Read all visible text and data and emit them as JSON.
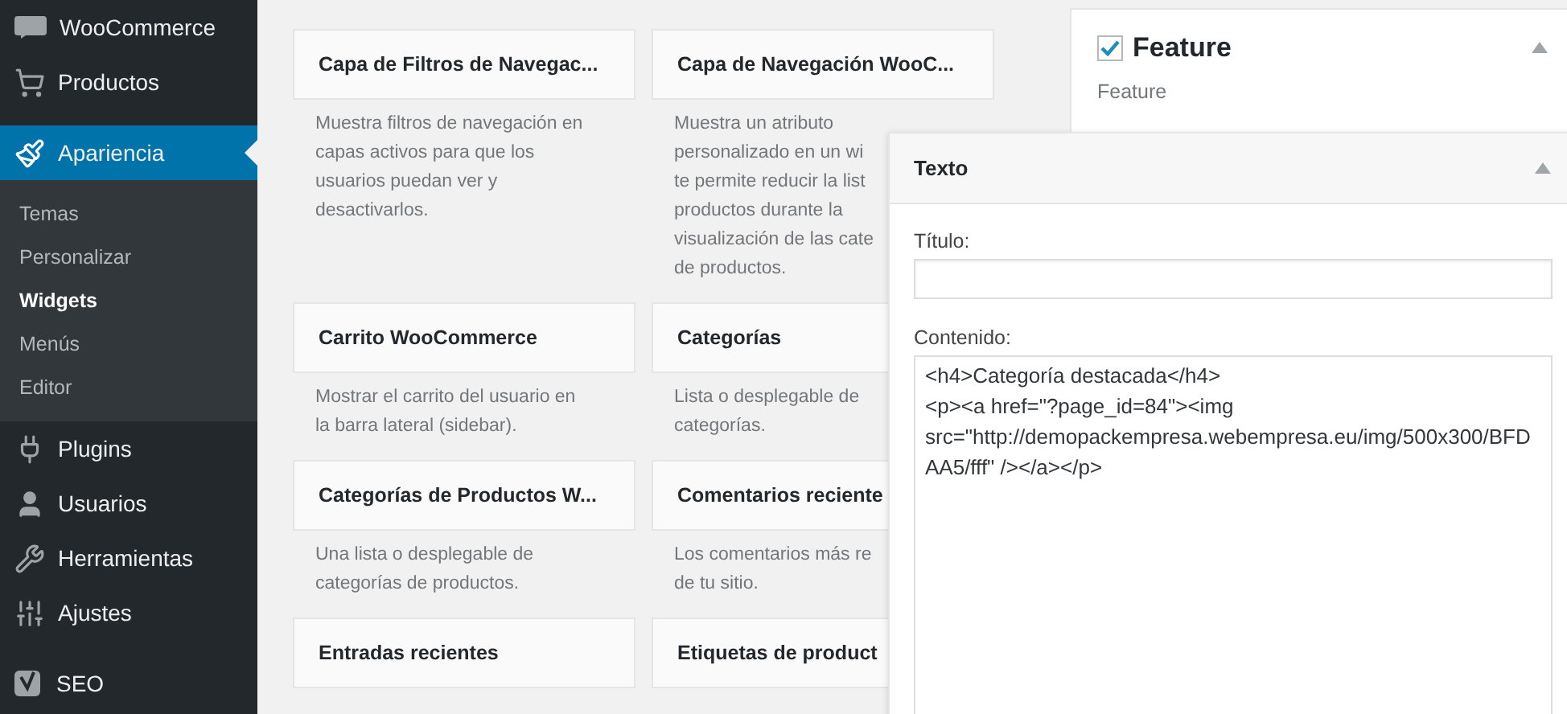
{
  "sidebar": {
    "items": [
      {
        "label": "WooCommerce",
        "selected": false
      },
      {
        "label": "Productos",
        "selected": false
      },
      {
        "label": "Apariencia",
        "selected": true,
        "children": [
          {
            "label": "Temas",
            "selected": false
          },
          {
            "label": "Personalizar",
            "selected": false
          },
          {
            "label": "Widgets",
            "selected": true
          },
          {
            "label": "Menús",
            "selected": false
          },
          {
            "label": "Editor",
            "selected": false
          }
        ]
      },
      {
        "label": "Plugins",
        "selected": false
      },
      {
        "label": "Usuarios",
        "selected": false
      },
      {
        "label": "Herramientas",
        "selected": false
      },
      {
        "label": "Ajustes",
        "selected": false
      },
      {
        "label": "SEO",
        "selected": false
      }
    ]
  },
  "available_widgets": [
    {
      "title": "Capa de Filtros de Navegac...",
      "description": "Muestra filtros de navegación en\ncapas activos para que los\nusuarios puedan ver y\ndesactivarlos."
    },
    {
      "title": "Capa de Navegación WooC...",
      "description": "Muestra un atributo\npersonalizado en un wi\nte permite reducir la list\nproductos durante la\nvisualización de las cate\nde productos."
    },
    {
      "title": "Carrito WooCommerce",
      "description": "Mostrar el carrito del usuario en\nla barra lateral (sidebar)."
    },
    {
      "title": "Categorías",
      "description": "Lista o desplegable de\ncategorías."
    },
    {
      "title": "Categorías de Productos W...",
      "description": "Una lista o desplegable de\ncategorías de productos."
    },
    {
      "title": "Comentarios reciente",
      "description": "Los comentarios más re\nde tu sitio."
    },
    {
      "title": "Entradas recientes"
    },
    {
      "title": "Etiquetas de product"
    }
  ],
  "sidebar_widget": {
    "title": "Feature",
    "checked": true,
    "subtitle": "Feature"
  },
  "dragged_widget": {
    "title": "Texto",
    "title_field": {
      "label": "Título:"
    },
    "content_field": {
      "label": "Contenido:",
      "value": "<h4>Categoría destacada</h4>\n<p><a href=\"?page_id=84\"><img src=\"http://demopackempresa.webempresa.eu/img/500x300/BFDAA5/fff\" /></a></p>"
    }
  }
}
